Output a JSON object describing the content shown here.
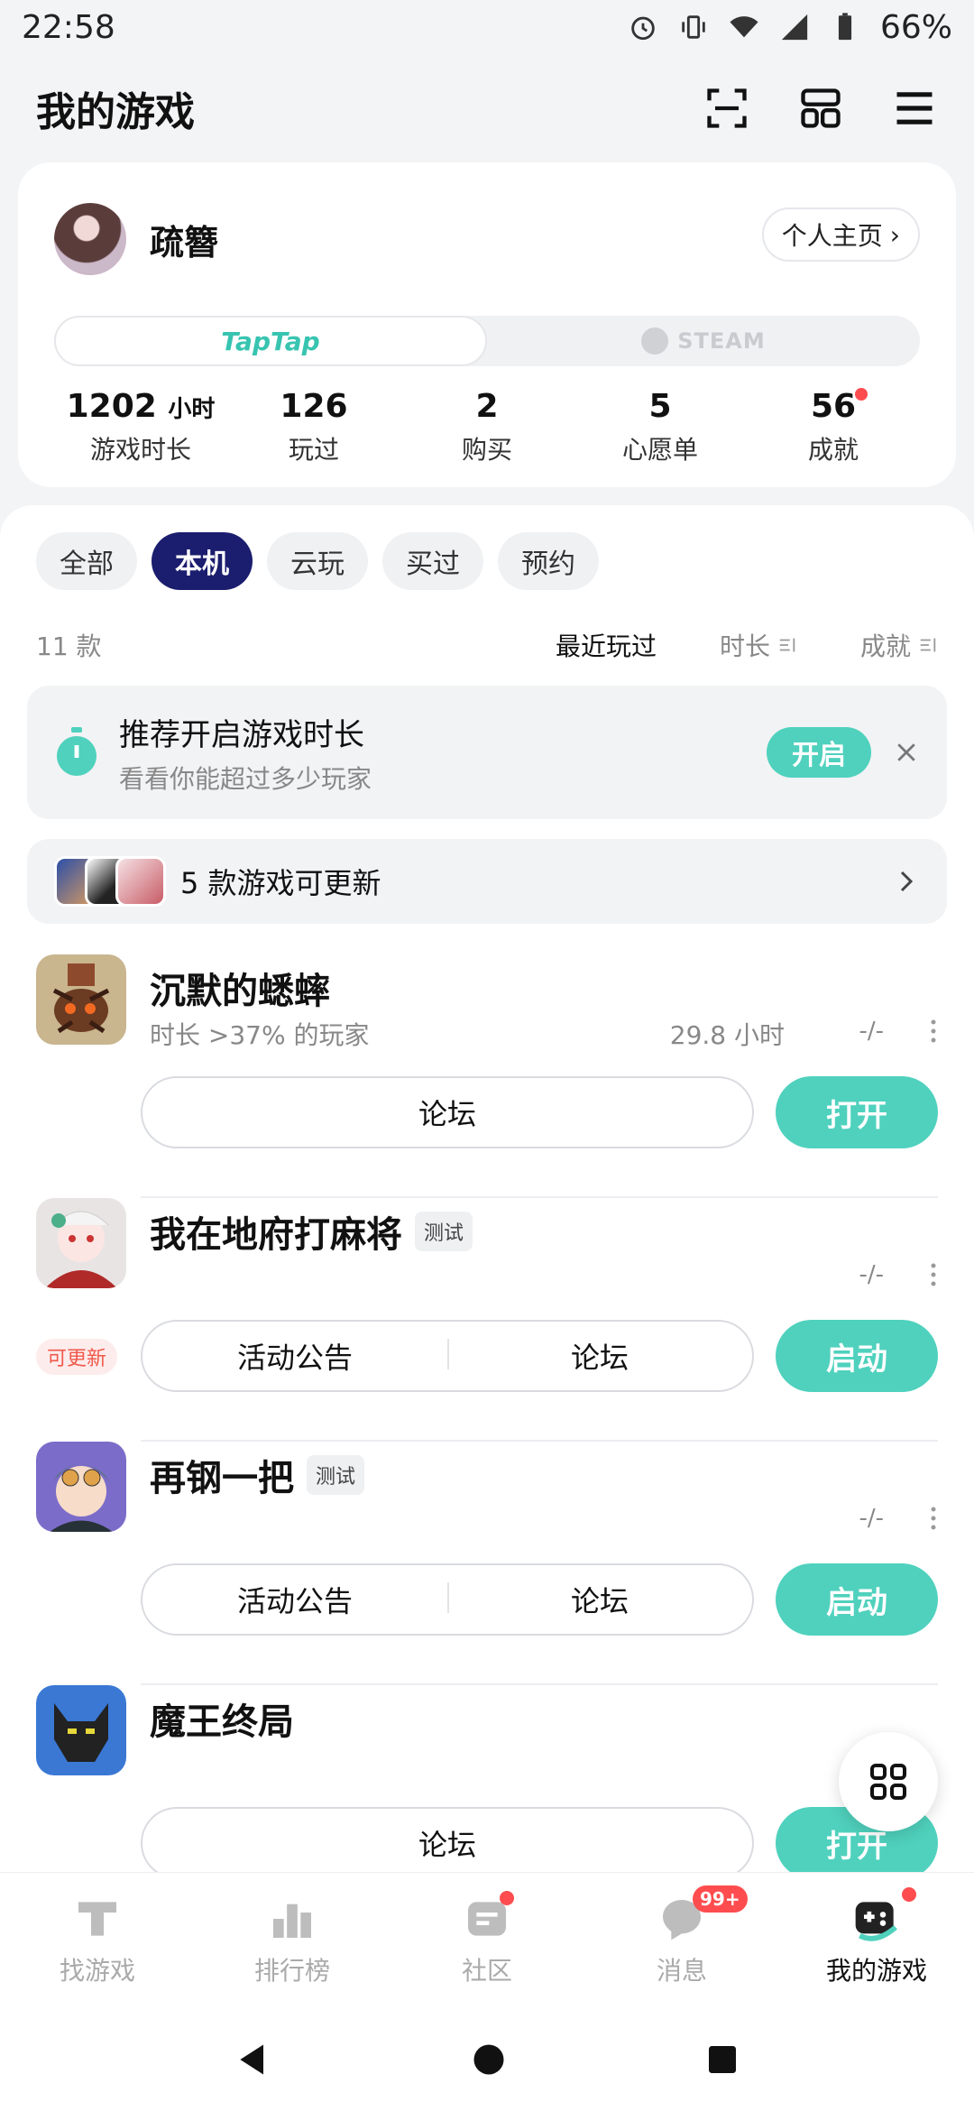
{
  "status": {
    "time": "22:58",
    "battery": "66%"
  },
  "header": {
    "title": "我的游戏"
  },
  "profile": {
    "username": "疏簪",
    "home_link": "个人主页",
    "platforms": {
      "taptap": "TapTap",
      "steam": "STEAM"
    },
    "stats": [
      {
        "value": "1202",
        "unit": "小时",
        "label": "游戏时长"
      },
      {
        "value": "126",
        "label": "玩过"
      },
      {
        "value": "2",
        "label": "购买"
      },
      {
        "value": "5",
        "label": "心愿单"
      },
      {
        "value": "56",
        "label": "成就"
      }
    ]
  },
  "filters": [
    "全部",
    "本机",
    "云玩",
    "买过",
    "预约"
  ],
  "active_filter": "本机",
  "sort": {
    "count": "11 款",
    "recent": "最近玩过",
    "duration": "时长",
    "achievement": "成就"
  },
  "recommend": {
    "title": "推荐开启游戏时长",
    "subtitle": "看看你能超过多少玩家",
    "button": "开启"
  },
  "updates": {
    "text": "5 款游戏可更新"
  },
  "games": [
    {
      "name": "沉默的蟋蟀",
      "subtitle": "时长 >37% 的玩家",
      "hours": "29.8 小时",
      "achievement": "-/-",
      "buttons": [
        "论坛"
      ],
      "primary": "打开"
    },
    {
      "name": "我在地府打麻将",
      "badge": "测试",
      "achievement": "-/-",
      "update_badge": "可更新",
      "buttons": [
        "活动公告",
        "论坛"
      ],
      "primary": "启动"
    },
    {
      "name": "再钢一把",
      "badge": "测试",
      "achievement": "-/-",
      "buttons": [
        "活动公告",
        "论坛"
      ],
      "primary": "启动"
    },
    {
      "name": "魔王终局",
      "buttons": [
        "论坛"
      ],
      "primary": "打开"
    }
  ],
  "nav": [
    {
      "label": "找游戏",
      "icon": "tap-icon"
    },
    {
      "label": "排行榜",
      "icon": "ranking-icon"
    },
    {
      "label": "社区",
      "icon": "community-icon"
    },
    {
      "label": "消息",
      "icon": "message-icon",
      "badge": "99+"
    },
    {
      "label": "我的游戏",
      "icon": "my-games-icon"
    }
  ],
  "colors": {
    "accent": "#4fd1bd",
    "filter_active": "#1b1d6e",
    "alert": "#ff4d4f"
  }
}
